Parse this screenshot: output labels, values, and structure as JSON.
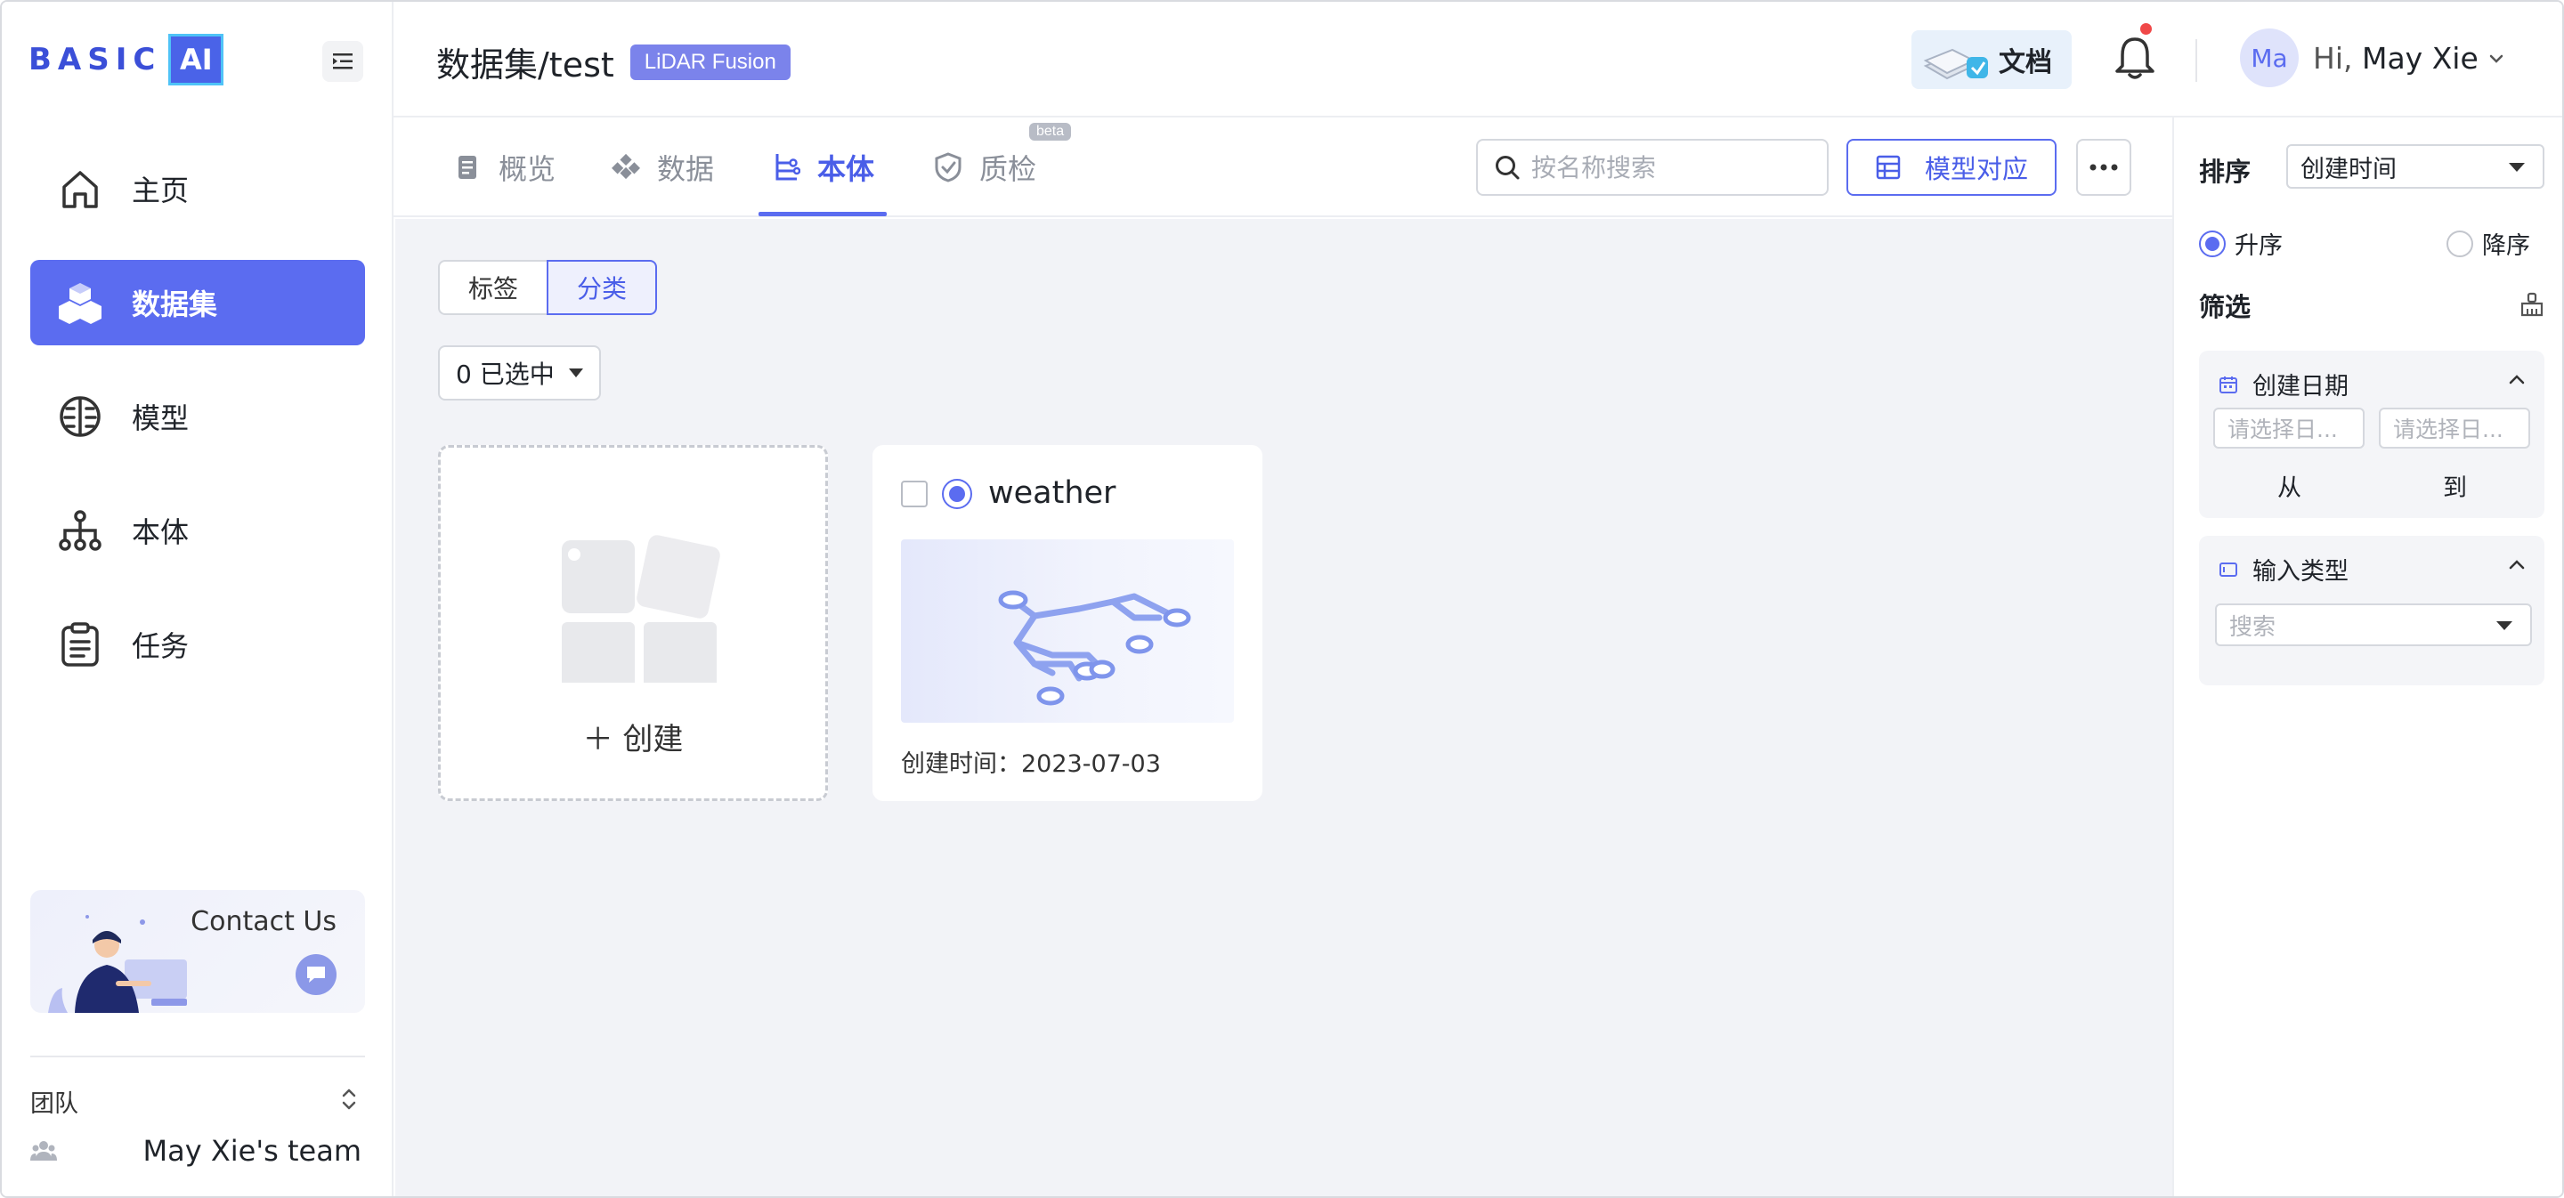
{
  "brand": {
    "logo_text": "BASIC",
    "logo_ai": "AI",
    "accent": "#5b6cf0"
  },
  "sidebar": {
    "items": [
      {
        "label": "主页",
        "icon": "home-icon"
      },
      {
        "label": "数据集",
        "icon": "cubes-icon",
        "active": true
      },
      {
        "label": "模型",
        "icon": "brain-icon"
      },
      {
        "label": "本体",
        "icon": "hierarchy-icon"
      },
      {
        "label": "任务",
        "icon": "clipboard-icon"
      }
    ],
    "contact": {
      "title": "Contact Us"
    },
    "team": {
      "label": "团队",
      "name": "May Xie's team"
    }
  },
  "header": {
    "breadcrumb": "数据集/test",
    "badge": "LiDAR Fusion",
    "docs_label": "文档",
    "avatar_initials": "Ma",
    "greeting_hi": "Hi,",
    "user_name": "May Xie"
  },
  "tabs": {
    "items": [
      {
        "label": "概览",
        "icon": "overview-icon"
      },
      {
        "label": "数据",
        "icon": "data-icon"
      },
      {
        "label": "本体",
        "icon": "ontology-icon",
        "active": true
      },
      {
        "label": "质检",
        "icon": "shield-check-icon"
      }
    ],
    "beta_tag": "beta",
    "search_placeholder": "按名称搜索",
    "model_map_label": "模型对应"
  },
  "main": {
    "segments": [
      "标签",
      "分类"
    ],
    "active_segment": "分类",
    "selected_dropdown": "0 已选中",
    "create_label": "创建",
    "cards": [
      {
        "title": "weather",
        "created_label": "创建时间：",
        "created_date": "2023-07-03"
      }
    ]
  },
  "right_panel": {
    "sort_label": "排序",
    "sort_value": "创建时间",
    "asc_label": "升序",
    "desc_label": "降序",
    "sort_order": "升序",
    "filter_label": "筛选",
    "date_filter": {
      "title": "创建日期",
      "from_placeholder": "请选择日...",
      "to_placeholder": "请选择日...",
      "from_label": "从",
      "to_label": "到"
    },
    "type_filter": {
      "title": "输入类型",
      "placeholder": "搜索"
    }
  }
}
